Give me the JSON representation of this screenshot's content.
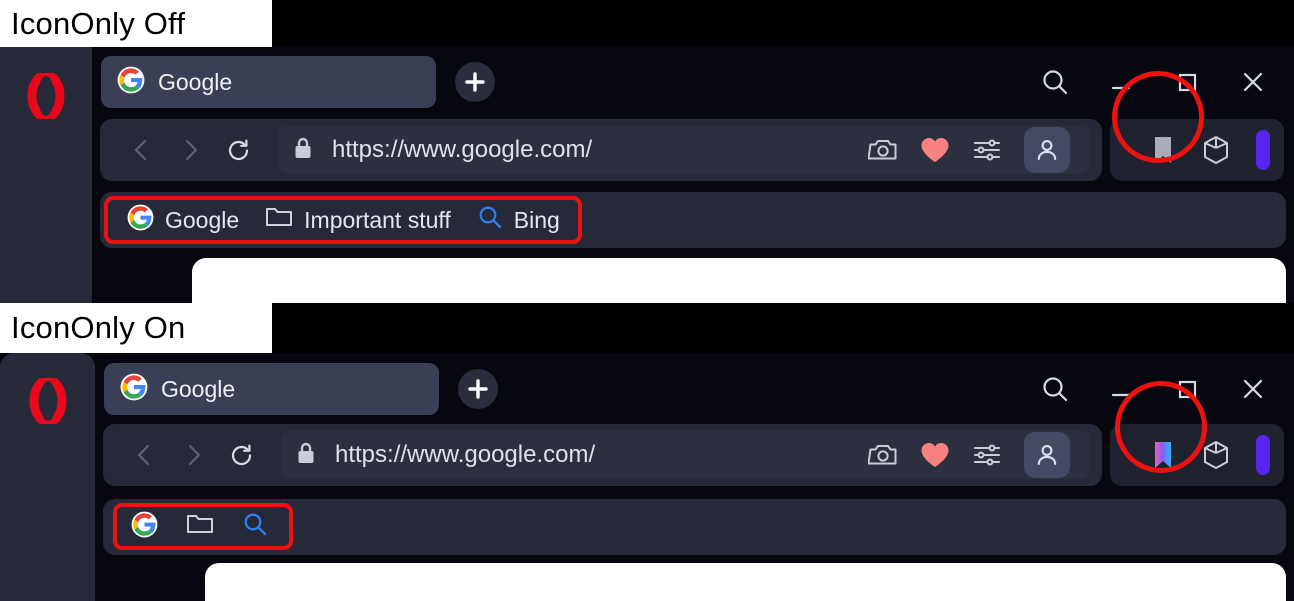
{
  "annotations": {
    "label_off": "IconOnly Off",
    "label_on": "IconOnly On",
    "highlight_color": "#ee1111"
  },
  "theme": {
    "window_bg": "#06070f",
    "sidebar_bg": "#272a38",
    "toolbar_bg": "#262a38",
    "tab_active_bg": "#3b3f55",
    "text": "#e4e7f0",
    "accent_purple": "#5626f0",
    "heart_red": "#f78282"
  },
  "browser": {
    "sidebar": {
      "logo": "opera-logo"
    },
    "tabstrip": {
      "tabs": [
        {
          "favicon": "google-icon",
          "title": "Google"
        }
      ],
      "new_tab_label": "+",
      "window_controls": [
        {
          "name": "search-icon"
        },
        {
          "name": "minimize-icon"
        },
        {
          "name": "maximize-icon"
        },
        {
          "name": "close-icon"
        }
      ]
    },
    "addressbar": {
      "back": "back-arrow-icon",
      "forward": "forward-arrow-icon",
      "reload": "reload-icon",
      "security": "lock-icon",
      "url": "https://www.google.com/",
      "actions": [
        {
          "name": "snapshot-camera-icon"
        },
        {
          "name": "heart-icon"
        },
        {
          "name": "page-settings-icon"
        },
        {
          "name": "profile-icon"
        }
      ],
      "right_group": [
        {
          "name": "bookmarks-icon"
        },
        {
          "name": "extensions-cube-icon"
        },
        {
          "name": "accent-pill"
        }
      ]
    },
    "bookmarks_bar": {
      "items": [
        {
          "icon": "google-icon",
          "label": "Google"
        },
        {
          "icon": "folder-icon",
          "label": "Important stuff"
        },
        {
          "icon": "search-icon",
          "label": "Bing"
        }
      ]
    }
  },
  "panels": [
    {
      "state": "off",
      "icon_only": false
    },
    {
      "state": "on",
      "icon_only": true
    }
  ]
}
